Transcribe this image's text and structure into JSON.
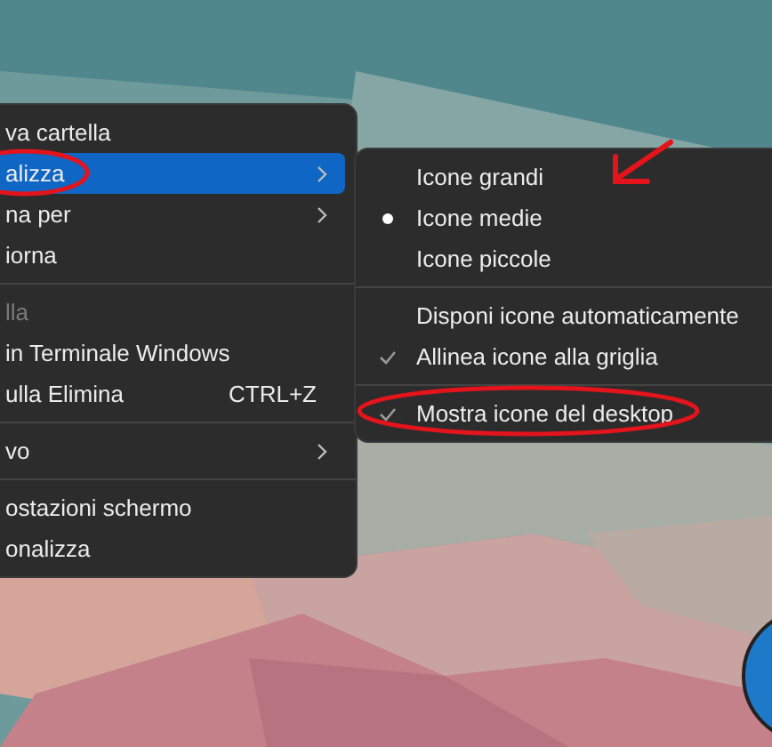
{
  "context_menu": {
    "items": [
      {
        "kind": "item",
        "label": "va cartella",
        "submenu": false,
        "disabled": false,
        "selected": false
      },
      {
        "kind": "item",
        "label": "alizza",
        "submenu": true,
        "disabled": false,
        "selected": true
      },
      {
        "kind": "item",
        "label": "na per",
        "submenu": true,
        "disabled": false,
        "selected": false
      },
      {
        "kind": "item",
        "label": "iorna",
        "submenu": false,
        "disabled": false,
        "selected": false
      },
      {
        "kind": "separator"
      },
      {
        "kind": "item",
        "label": "lla",
        "submenu": false,
        "disabled": true,
        "selected": false
      },
      {
        "kind": "item",
        "label": "in Terminale Windows",
        "submenu": false,
        "disabled": false,
        "selected": false
      },
      {
        "kind": "item",
        "label": "ulla Elimina",
        "shortcut": "CTRL+Z",
        "submenu": false,
        "disabled": false,
        "selected": false
      },
      {
        "kind": "separator"
      },
      {
        "kind": "item",
        "label": "vo",
        "submenu": true,
        "disabled": false,
        "selected": false
      },
      {
        "kind": "separator"
      },
      {
        "kind": "item",
        "label": "ostazioni schermo",
        "submenu": false,
        "disabled": false,
        "selected": false
      },
      {
        "kind": "item",
        "label": "onalizza",
        "submenu": false,
        "disabled": false,
        "selected": false
      }
    ]
  },
  "submenu": {
    "items": [
      {
        "kind": "radio",
        "label": "Icone grandi",
        "selected": false
      },
      {
        "kind": "radio",
        "label": "Icone medie",
        "selected": true
      },
      {
        "kind": "radio",
        "label": "Icone piccole",
        "selected": false
      },
      {
        "kind": "separator"
      },
      {
        "kind": "check",
        "label": "Disponi icone automaticamente",
        "checked": false
      },
      {
        "kind": "check",
        "label": "Allinea icone alla griglia",
        "checked": true
      },
      {
        "kind": "separator"
      },
      {
        "kind": "check",
        "label": "Mostra icone del desktop",
        "checked": true
      }
    ]
  }
}
